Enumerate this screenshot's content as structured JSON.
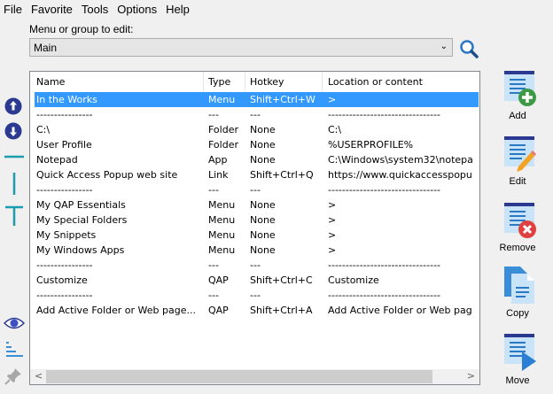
{
  "menu": [
    "File",
    "Favorite",
    "Tools",
    "Options",
    "Help"
  ],
  "editor": {
    "label": "Menu or group to edit:",
    "selected": "Main"
  },
  "columns": [
    "Name",
    "Type",
    "Hotkey",
    "Location or content"
  ],
  "rows": [
    [
      "In the Works",
      "Menu",
      "Shift+Ctrl+W",
      ">"
    ],
    [
      "----------------",
      "---",
      "---",
      "--------------------------------"
    ],
    [
      "C:\\",
      "Folder",
      "None",
      "C:\\"
    ],
    [
      "User Profile",
      "Folder",
      "None",
      "%USERPROFILE%"
    ],
    [
      "Notepad",
      "App",
      "None",
      "C:\\Windows\\system32\\notepa"
    ],
    [
      "Quick Access Popup web site",
      "Link",
      "Shift+Ctrl+Q",
      "https://www.quickaccesspopu"
    ],
    [
      "----------------",
      "---",
      "---",
      "--------------------------------"
    ],
    [
      "My QAP Essentials",
      "Menu",
      "None",
      ">"
    ],
    [
      "My Special Folders",
      "Menu",
      "None",
      ">"
    ],
    [
      "My Snippets",
      "Menu",
      "None",
      ">"
    ],
    [
      "My Windows Apps",
      "Menu",
      "None",
      ">"
    ],
    [
      "----------------",
      "---",
      "---",
      "--------------------------------"
    ],
    [
      "Customize",
      "QAP",
      "Shift+Ctrl+C",
      "Customize"
    ],
    [
      "----------------",
      "---",
      "---",
      "--------------------------------"
    ],
    [
      "Add Active Folder or Web page...",
      "QAP",
      "Shift+Ctrl+A",
      "Add Active Folder or Web pag"
    ]
  ],
  "selected_row": 0,
  "buttons": {
    "add": "Add",
    "edit": "Edit",
    "remove": "Remove",
    "copy": "Copy",
    "move": "Move"
  },
  "colors": {
    "selection": "#3399ff",
    "accent": "#2b3990",
    "teal": "#1a9bb0"
  }
}
